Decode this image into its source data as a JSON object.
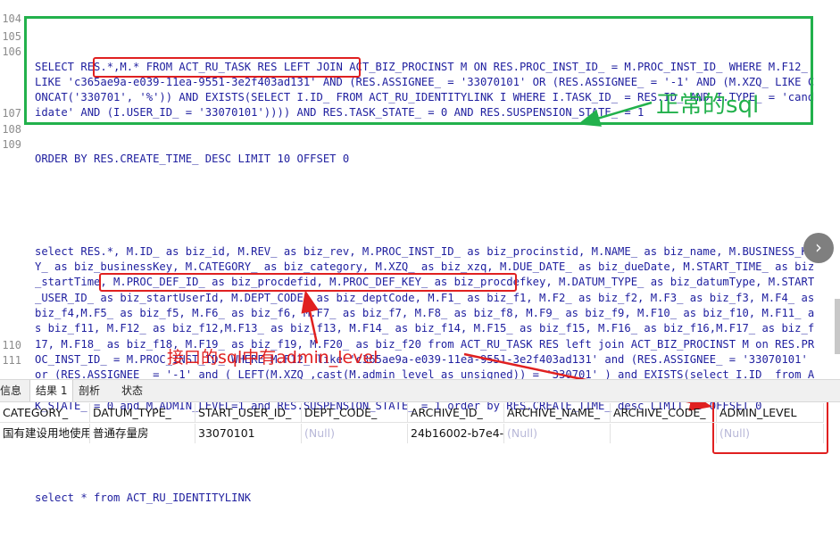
{
  "editor": {
    "line_numbers": [
      "104",
      "105",
      "106",
      "107",
      "108",
      "109",
      "110",
      "111"
    ],
    "sql_line1": "SELECT RES.*,M.* FROM ACT_RU_TASK RES LEFT JOIN ACT_BIZ_PROCINST M ON RES.PROC_INST_ID_ = M.PROC_INST_ID_ WHERE M.F12_ LIKE 'c365ae9a-e039-11ea-9551-3e2f403ad131' AND (RES.ASSIGNEE_ = '33070101' OR (RES.ASSIGNEE_ = '-1' AND (M.XZQ_ LIKE CONCAT('330701', '%')) AND EXISTS(SELECT I.ID_ FROM ACT_RU_IDENTITYLINK I WHERE I.TASK_ID_ = RES.ID_ AND I.TYPE_ = 'candidate' AND (I.USER_ID_ = '33070101')))) AND RES.TASK_STATE_ = 0 AND RES.SUSPENSION_STATE_ = 1",
    "sql_line2": "ORDER BY RES.CREATE_TIME_ DESC LIMIT 10 OFFSET 0",
    "sql_line3": "select RES.*, M.ID_ as biz_id, M.REV_ as biz_rev, M.PROC_INST_ID_ as biz_procinstid, M.NAME_ as biz_name, M.BUSINESS_KEY_ as biz_businessKey, M.CATEGORY_ as biz_category, M.XZQ_ as biz_xzq, M.DUE_DATE_ as biz_dueDate, M.START_TIME_ as biz_startTime, M.PROC_DEF_ID_ as biz_procdefid, M.PROC_DEF_KEY_ as biz_procdefkey, M.DATUM_TYPE_ as biz_datumType, M.START_USER_ID_ as biz_startUserId, M.DEPT_CODE_ as biz_deptCode, M.F1_ as biz_f1, M.F2_ as biz_f2, M.F3_ as biz_f3, M.F4_ as biz_f4,M.F5_ as biz_f5, M.F6_ as biz_f6, M.F7_ as biz_f7, M.F8_ as biz_f8, M.F9_ as biz_f9, M.F10_ as biz_f10, M.F11_ as biz_f11, M.F12_ as biz_f12,M.F13_ as biz_f13, M.F14_ as biz_f14, M.F15_ as biz_f15, M.F16_ as biz_f16,M.F17_ as biz_f17, M.F18_ as biz_f18, M.F19_ as biz_f19, M.F20_ as biz_f20 from ACT_RU_TASK RES left join ACT_BIZ_PROCINST M on RES.PROC_INST_ID_ = M.PROC_INST_ID_ WHERE M.F12_ like 'c365ae9a-e039-11ea-9551-3e2f403ad131' and (RES.ASSIGNEE_ = '33070101' or (RES.ASSIGNEE_ = '-1' and ( LEFT(M.XZQ_,cast(M.admin_level as unsigned)) = '330701' ) and EXISTS(select I.ID_ from ACT_RU_IDENTITYLINK I where I.TASK_ID_ = RES.ID_ and I.TYPE_ = 'candidate' and (I.USER_ID_ = '33070101' )))) and RES.TASK_STATE_ = 0 and M.ADMIN_LEVEL=1 and RES.SUSPENSION_STATE_ = 1 order by RES.CREATE_TIME_ desc LIMIT 10 OFFSET 0",
    "sql_line4": "select * from ACT_RU_IDENTITYLINK"
  },
  "annotations": {
    "normal_sql": "正常的sql",
    "interface_sql": "接口的sql中有admin_level"
  },
  "tabs": [
    {
      "label": "信息"
    },
    {
      "label": "结果 1"
    },
    {
      "label": "剖析"
    },
    {
      "label": "状态"
    }
  ],
  "grid": {
    "columns": [
      "CATEGORY_",
      "DATUM_TYPE_",
      "START_USER_ID_",
      "DEPT_CODE_",
      "ARCHIVE_ID_",
      "ARCHIVE_NAME_",
      "ARCHIVE_CODE_",
      "ADMIN_LEVEL"
    ],
    "row": [
      "国有建设用地使用",
      "普通存量房",
      "33070101",
      "(Null)",
      "24b16002-b7e4-",
      "(Null)",
      "",
      "(Null)"
    ]
  },
  "colors": {
    "green": "#22b14c",
    "red": "#e02020"
  },
  "icons": {
    "scroll_button": "chevron-right-icon"
  }
}
